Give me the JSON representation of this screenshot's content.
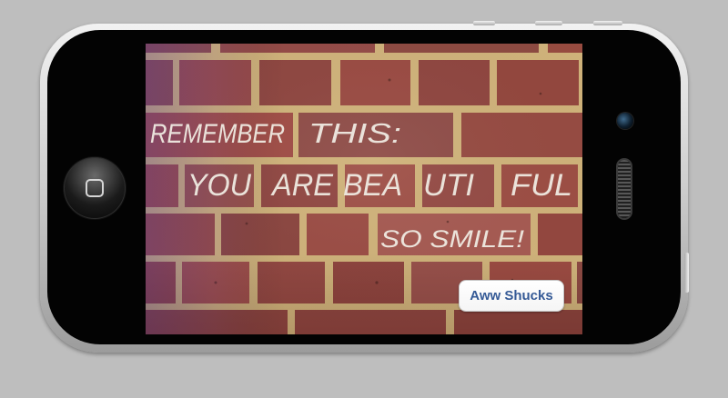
{
  "device": {
    "name": "iPhone 4",
    "orientation": "landscape",
    "color": "black"
  },
  "screen": {
    "photo_text": {
      "line1": [
        "REMEMBER",
        "THIS:"
      ],
      "line2": [
        "YOU",
        "ARE",
        "BEA",
        "UTI",
        "FUL"
      ],
      "line3": "SO SMILE!"
    },
    "button": {
      "label": "Aww Shucks"
    }
  },
  "colors": {
    "brick": "#8f443a",
    "mortar": "#c9ad76",
    "chalk": "#f2efe6",
    "button_text": "#355a96"
  }
}
